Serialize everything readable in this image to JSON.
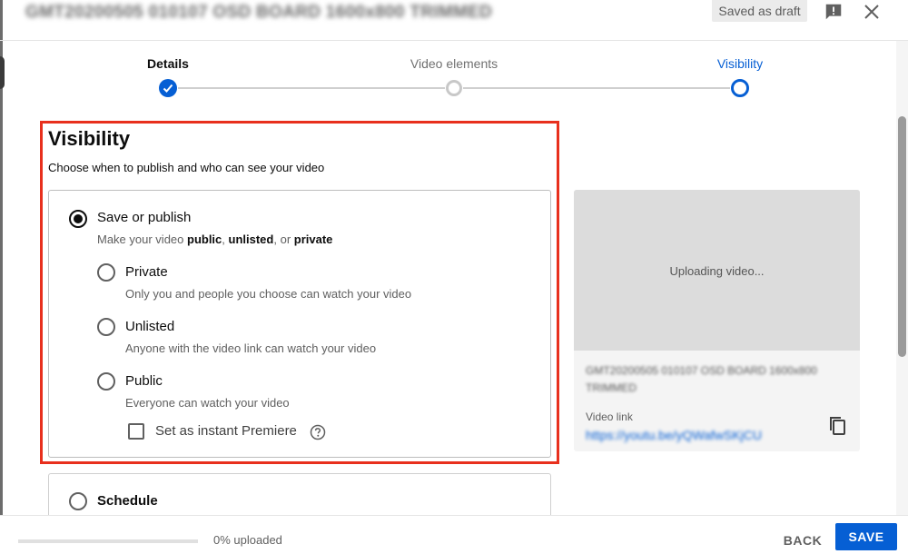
{
  "header": {
    "title": "GMT20200505 010107 OSD BOARD 1600x800 TRIMMED",
    "draft_status": "Saved as draft",
    "icons": [
      "feedback-icon",
      "close-icon"
    ]
  },
  "stepper": {
    "steps": [
      {
        "label": "Details",
        "state": "done"
      },
      {
        "label": "Video elements",
        "state": "pending"
      },
      {
        "label": "Visibility",
        "state": "current"
      }
    ]
  },
  "visibility": {
    "title": "Visibility",
    "subtitle": "Choose when to publish and who can see your video",
    "save_or_publish": {
      "label": "Save or publish",
      "desc_prefix": "Make your video ",
      "desc_public": "public",
      "desc_sep1": ", ",
      "desc_unlisted": "unlisted",
      "desc_sep2": ", or ",
      "desc_private": "private",
      "selected": true
    },
    "options": [
      {
        "label": "Private",
        "desc": "Only you and people you choose can watch your video"
      },
      {
        "label": "Unlisted",
        "desc": "Anyone with the video link can watch your video"
      },
      {
        "label": "Public",
        "desc": "Everyone can watch your video"
      }
    ],
    "premiere_label": "Set as instant Premiere",
    "schedule_label": "Schedule"
  },
  "preview": {
    "status": "Uploading video...",
    "file_name": "GMT20200505 010107 OSD BOARD 1600x800 TRIMMED",
    "video_link_label": "Video link",
    "video_link": "https://youtu.be/yQWafwSKjCU"
  },
  "footer": {
    "progress_text": "0% uploaded",
    "progress_fraction": 0,
    "back_label": "BACK",
    "save_label": "SAVE"
  },
  "colors": {
    "accent": "#065fd4",
    "highlight": "#e8301d"
  }
}
